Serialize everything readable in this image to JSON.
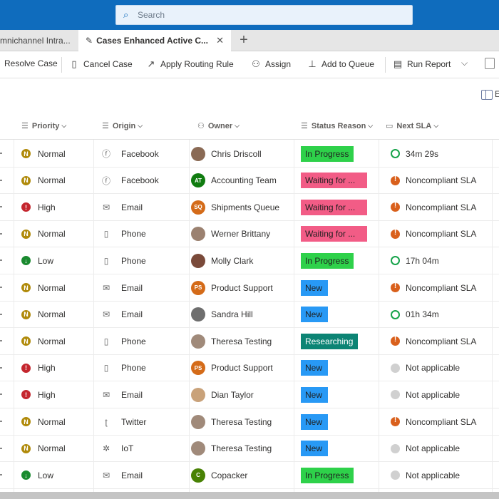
{
  "search": {
    "placeholder": "Search"
  },
  "tabs": [
    {
      "label": "mnichannel Intra...",
      "active": false
    },
    {
      "label": "Cases Enhanced Active C...",
      "active": true
    }
  ],
  "commands": [
    {
      "label": "Resolve Case",
      "icon": "resolve-icon"
    },
    {
      "label": "Cancel Case",
      "icon": "document-cancel-icon"
    },
    {
      "label": "Apply Routing Rule",
      "icon": "routing-icon"
    },
    {
      "label": "Assign",
      "icon": "person-assign-icon"
    },
    {
      "label": "Add to Queue",
      "icon": "queue-icon"
    },
    {
      "label": "Run Report",
      "icon": "report-icon"
    }
  ],
  "columns": {
    "priority": "Priority",
    "origin": "Origin",
    "owner": "Owner",
    "status_reason": "Status Reason",
    "next_sla": "Next SLA"
  },
  "colors": {
    "brand": "#0f6cbd",
    "status_in_progress": "#2ed14a",
    "status_waiting": "#f25c86",
    "status_new": "#2899f5",
    "status_researching": "#0c8474",
    "priority_normal": "#b08a0a",
    "priority_high": "#c4262e",
    "priority_low": "#1a8a2f"
  },
  "rows": [
    {
      "priority": "Normal",
      "origin": "Facebook",
      "origin_icon": "facebook-icon",
      "owner": "Chris Driscoll",
      "owner_initials": "",
      "avatar_color": "#8a6a55",
      "status": "In Progress",
      "status_type": "in_progress",
      "sla": "34m 29s",
      "sla_type": "ring"
    },
    {
      "priority": "Normal",
      "origin": "Facebook",
      "origin_icon": "facebook-icon",
      "owner": "Accounting Team",
      "owner_initials": "AT",
      "avatar_color": "#107c10",
      "status": "Waiting for ...",
      "status_type": "waiting",
      "sla": "Noncompliant SLA",
      "sla_type": "warn"
    },
    {
      "priority": "High",
      "origin": "Email",
      "origin_icon": "email-icon",
      "owner": "Shipments Queue",
      "owner_initials": "SQ",
      "avatar_color": "#d46b19",
      "status": "Waiting for ...",
      "status_type": "waiting",
      "sla": "Noncompliant SLA",
      "sla_type": "warn"
    },
    {
      "priority": "Normal",
      "origin": "Phone",
      "origin_icon": "phone-icon",
      "owner": "Werner Brittany",
      "owner_initials": "",
      "avatar_color": "#9b8170",
      "status": "Waiting for ...",
      "status_type": "waiting",
      "sla": "Noncompliant SLA",
      "sla_type": "warn"
    },
    {
      "priority": "Low",
      "origin": "Phone",
      "origin_icon": "phone-icon",
      "owner": "Molly Clark",
      "owner_initials": "",
      "avatar_color": "#7a4a3a",
      "status": "In Progress",
      "status_type": "in_progress",
      "sla": "17h 04m",
      "sla_type": "ring"
    },
    {
      "priority": "Normal",
      "origin": "Email",
      "origin_icon": "email-icon",
      "owner": "Product Support",
      "owner_initials": "PS",
      "avatar_color": "#d46b19",
      "status": "New",
      "status_type": "new",
      "sla": "Noncompliant SLA",
      "sla_type": "warn"
    },
    {
      "priority": "Normal",
      "origin": "Email",
      "origin_icon": "email-icon",
      "owner": "Sandra Hill",
      "owner_initials": "",
      "avatar_color": "#6e6e6e",
      "status": "New",
      "status_type": "new",
      "sla": "01h 34m",
      "sla_type": "ring"
    },
    {
      "priority": "Normal",
      "origin": "Phone",
      "origin_icon": "phone-icon",
      "owner": "Theresa Testing",
      "owner_initials": "",
      "avatar_color": "#a08a7a",
      "status": "Researching",
      "status_type": "researching",
      "sla": "Noncompliant SLA",
      "sla_type": "warn"
    },
    {
      "priority": "High",
      "origin": "Phone",
      "origin_icon": "phone-icon",
      "owner": "Product Support",
      "owner_initials": "PS",
      "avatar_color": "#d46b19",
      "status": "New",
      "status_type": "new",
      "sla": "Not applicable",
      "sla_type": "na"
    },
    {
      "priority": "High",
      "origin": "Email",
      "origin_icon": "email-icon",
      "owner": "Dian Taylor",
      "owner_initials": "",
      "avatar_color": "#c9a27a",
      "status": "New",
      "status_type": "new",
      "sla": "Not applicable",
      "sla_type": "na"
    },
    {
      "priority": "Normal",
      "origin": "Twitter",
      "origin_icon": "twitter-icon",
      "owner": "Theresa Testing",
      "owner_initials": "",
      "avatar_color": "#a08a7a",
      "status": "New",
      "status_type": "new",
      "sla": "Noncompliant SLA",
      "sla_type": "warn"
    },
    {
      "priority": "Normal",
      "origin": "IoT",
      "origin_icon": "iot-icon",
      "owner": "Theresa Testing",
      "owner_initials": "",
      "avatar_color": "#a08a7a",
      "status": "New",
      "status_type": "new",
      "sla": "Not applicable",
      "sla_type": "na"
    },
    {
      "priority": "Low",
      "origin": "Email",
      "origin_icon": "email-icon",
      "owner": "Copacker",
      "owner_initials": "C",
      "avatar_color": "#498205",
      "status": "In Progress",
      "status_type": "in_progress",
      "sla": "Not applicable",
      "sla_type": "na"
    }
  ]
}
